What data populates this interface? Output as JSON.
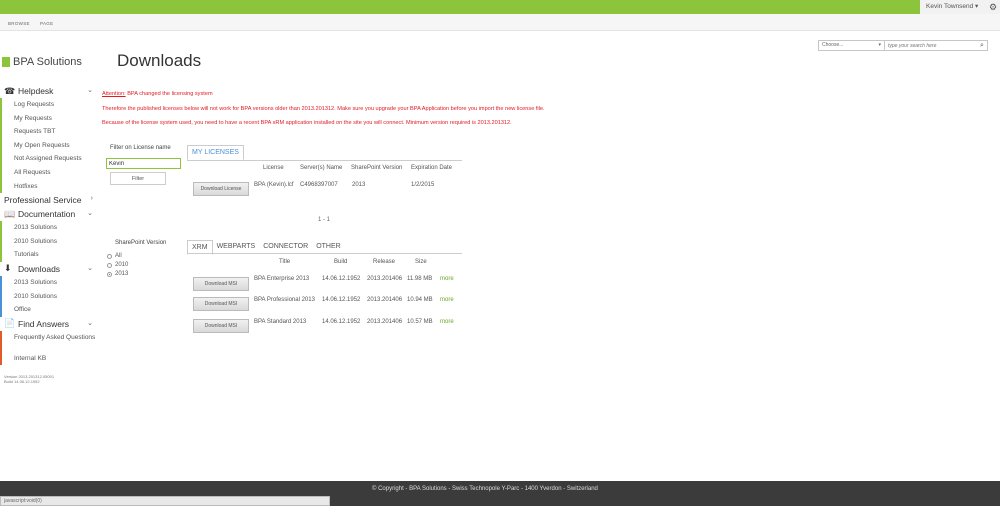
{
  "topbar": {
    "user": "Kevin Townsend",
    "user_caret": "▾",
    "gear": "⚙"
  },
  "ribbon": {
    "browse": "BROWSE",
    "page": "PAGE"
  },
  "search": {
    "scope": "Choose...",
    "scope_arrow": "▾",
    "placeholder": "type your search here",
    "icon": "⌕"
  },
  "logo": {
    "text": "BPA Solutions"
  },
  "page_title": "Downloads",
  "nav": {
    "helpdesk": {
      "label": "Helpdesk",
      "icon": "☎",
      "chev": "⌄",
      "items": [
        "Log Requests",
        "My Requests",
        "Requests TBT",
        "My Open Requests",
        "Not Assigned Requests",
        "All Requests",
        "Hotfixes"
      ]
    },
    "professional": {
      "label": "Professional Service",
      "chev": "›"
    },
    "documentation": {
      "label": "Documentation",
      "icon": "📖",
      "chev": "⌄",
      "items": [
        "2013 Solutions",
        "2010 Solutions",
        "Tutorials"
      ]
    },
    "downloads": {
      "label": "Downloads",
      "icon": "⬇",
      "chev": "⌄",
      "items": [
        "2013 Solutions",
        "2010 Solutions",
        "Office"
      ]
    },
    "find_answers": {
      "label": "Find Answers",
      "icon": "📄",
      "chev": "⌄",
      "items": [
        "Frequently Asked Questions",
        "Internal KB"
      ]
    }
  },
  "version": {
    "line1": "Version 2013.201312.05001",
    "line2": "Build 14.06.12.1952"
  },
  "alerts": {
    "attention": "Attention:",
    "line1_rest": " BPA changed the licensing system",
    "line2": "Therefore the published licenses below will not work for BPA versions older than 2013.201312. Make sure you upgrade your BPA Application before you import the new license file.",
    "line3": "Because of the license system used, you need to have a recent BPA xRM application installed on the site you will connect. Minimum version required is 2013.201312."
  },
  "filter": {
    "label": "Filter on License name",
    "value": "Kevin",
    "button": "Filter"
  },
  "licenses": {
    "tab": "MY LICENSES",
    "headers": {
      "license": "License",
      "servers": "Server(s) Name",
      "sp": "SharePoint Version",
      "exp": "Expiration Date"
    },
    "rows": [
      {
        "button": "Download License",
        "license": "BPA (Kevin).lcf",
        "servers": "C4968397007",
        "sp": "2013",
        "exp": "1/2/2015"
      }
    ],
    "pager": "1 - 1"
  },
  "sp_version": {
    "label": "SharePoint Version",
    "options": [
      "All",
      "2010",
      "2013"
    ]
  },
  "products": {
    "tabs": [
      "XRM",
      "WEBPARTS",
      "CONNECTOR",
      "OTHER"
    ],
    "headers": {
      "title": "Title",
      "build": "Build",
      "release": "Release",
      "size": "Size"
    },
    "rows": [
      {
        "button": "Download MSI",
        "title": "BPA Enterprise 2013",
        "build": "14.06.12.1952",
        "release": "2013.201406",
        "size": "11.98 MB",
        "more": "more"
      },
      {
        "button": "Download MSI",
        "title": "BPA Professional 2013",
        "build": "14.06.12.1952",
        "release": "2013.201406",
        "size": "10.94 MB",
        "more": "more"
      },
      {
        "button": "Download MSI",
        "title": "BPA Standard 2013",
        "build": "14.06.12.1952",
        "release": "2013.201406",
        "size": "10.57 MB",
        "more": "more"
      }
    ]
  },
  "footer": {
    "text": "© Copyright - BPA Solutions - Swiss Technopole Y-Parc - 1400 Yverdon - Switzerland"
  },
  "statusbar": {
    "text": "javascript:void(0)"
  }
}
